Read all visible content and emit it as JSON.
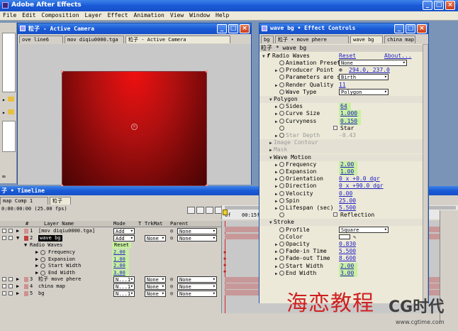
{
  "app": {
    "title": "Adobe After Effects"
  },
  "menu": [
    "File",
    "Edit",
    "Composition",
    "Layer",
    "Effect",
    "Animation",
    "View",
    "Window",
    "Help"
  ],
  "comp_window": {
    "title": "粒子 - Active Camera",
    "tabs": [
      "ove line6",
      "mov diqiu0000.tga",
      "粒子 - Active Camera"
    ]
  },
  "left_panel": {
    "icon_label": "∞"
  },
  "effect_controls": {
    "title": "wave bg • Effect Controls",
    "tabs": [
      "bg",
      "粒子 • move phere",
      "wave bg",
      "china map"
    ],
    "header": "粒子 * wave bg",
    "effect_name": "Radio Waves",
    "reset": "Reset",
    "about": "About...",
    "rows": [
      {
        "label": "Animation Presets",
        "value": "None",
        "kind": "dropdown"
      },
      {
        "label": "Producer Point",
        "value": "294.0, 237.0",
        "kind": "point"
      },
      {
        "label": "Parameters are s...",
        "value": "Birth",
        "kind": "dropdown"
      },
      {
        "label": "Render Quality",
        "value": "11",
        "kind": "num"
      },
      {
        "label": "Wave Type",
        "value": "Polygon",
        "kind": "dropdown"
      },
      {
        "label": "Polygon",
        "value": "",
        "kind": "group"
      },
      {
        "label": "Sides",
        "value": "64",
        "kind": "hl"
      },
      {
        "label": "Curve Size",
        "value": "1.000",
        "kind": "hl"
      },
      {
        "label": "Curvyness",
        "value": "0.150",
        "kind": "hl"
      },
      {
        "label": "",
        "value": "Star",
        "kind": "check"
      },
      {
        "label": "Star Depth",
        "value": "-0.43",
        "kind": "grey"
      },
      {
        "label": "Image Contour",
        "value": "",
        "kind": "greygroup"
      },
      {
        "label": "Mask",
        "value": "",
        "kind": "greygroup"
      },
      {
        "label": "Wave Motion",
        "value": "",
        "kind": "group"
      },
      {
        "label": "Frequency",
        "value": "2.00",
        "kind": "hl"
      },
      {
        "label": "Expansion",
        "value": "1.00",
        "kind": "hl"
      },
      {
        "label": "Orientation",
        "value": "0 x +0.0 dgr",
        "kind": "num"
      },
      {
        "label": "Direction",
        "value": "0 x +90.0 dgr",
        "kind": "num"
      },
      {
        "label": "Velocity",
        "value": "0.00",
        "kind": "num"
      },
      {
        "label": "Spin",
        "value": "25.00",
        "kind": "num"
      },
      {
        "label": "Lifespan (sec)",
        "value": "5.500",
        "kind": "num"
      },
      {
        "label": "",
        "value": "Reflection",
        "kind": "check"
      },
      {
        "label": "Stroke",
        "value": "",
        "kind": "group"
      },
      {
        "label": "Profile",
        "value": "Square",
        "kind": "dropdown"
      },
      {
        "label": "Color",
        "value": "",
        "kind": "color"
      },
      {
        "label": "Opacity",
        "value": "0.830",
        "kind": "num"
      },
      {
        "label": "Fade-in Time",
        "value": "5.500",
        "kind": "num"
      },
      {
        "label": "Fade-out Time",
        "value": "8.600",
        "kind": "num"
      },
      {
        "label": "Start Width",
        "value": "2.00",
        "kind": "hl"
      },
      {
        "label": "End Width",
        "value": "3.00",
        "kind": "hl"
      }
    ]
  },
  "timeline": {
    "title": "子 • Timeline",
    "tabs": [
      "map Comp 1",
      "粒子"
    ],
    "timecode": "0:00:00:00 (25.00 fps)",
    "columns": {
      "num": "#",
      "name": "Layer Name",
      "mode": "Mode",
      "t": "T",
      "trkmat": "TrkMat",
      "parent": "Parent"
    },
    "ruler": [
      "0f",
      "00:15f"
    ],
    "layers": [
      {
        "num": "1",
        "name": "[mov diqiu0000.tga]",
        "mode": "Add",
        "trk": "",
        "parent": "None"
      },
      {
        "num": "2",
        "name": "wave bg",
        "mode": "Add",
        "trk": "None",
        "parent": "None"
      },
      {
        "num": "3",
        "name": "粒子 move phere",
        "mode": "N...1",
        "trk": "None",
        "parent": "None"
      },
      {
        "num": "4",
        "name": "china map",
        "mode": "N...1",
        "trk": "None",
        "parent": "None"
      },
      {
        "num": "5",
        "name": "bg",
        "mode": "N...1",
        "trk": "None",
        "parent": "None"
      }
    ],
    "effect": {
      "name": "Radio Waves",
      "reset": "Reset"
    },
    "props": [
      {
        "name": "Frequency",
        "value": "2.00"
      },
      {
        "name": "Expansion",
        "value": "1.00"
      },
      {
        "name": "Start Width",
        "value": "2.00"
      },
      {
        "name": "End Width",
        "value": "3.00"
      }
    ]
  },
  "watermark": {
    "chinese": "海恋教程",
    "brand": "CG时代",
    "url": "www.cgtime.com"
  }
}
